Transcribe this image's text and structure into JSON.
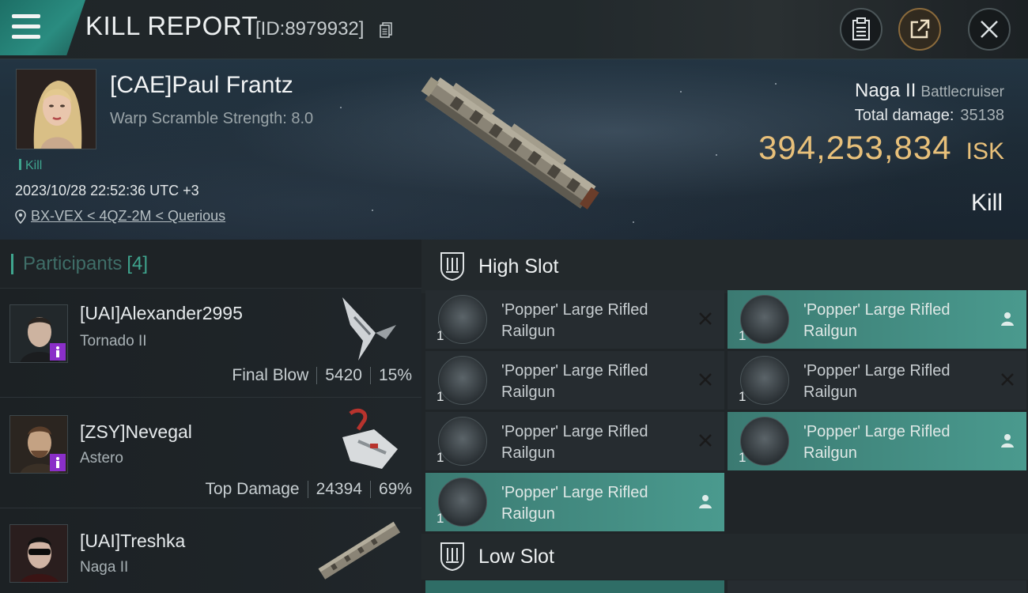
{
  "header": {
    "title": "KILL REPORT",
    "kill_id": "[ID:8979932]",
    "menu_icon": "hamburger-menu-icon",
    "copy_icon": "copy-icon",
    "buttons": [
      {
        "name": "clipboard-report-button",
        "icon": "clipboard-icon"
      },
      {
        "name": "share-export-button",
        "icon": "external-share-icon"
      },
      {
        "name": "close-button",
        "icon": "close-icon"
      }
    ]
  },
  "victim": {
    "name": "[CAE]Paul Frantz",
    "warp_scramble": "Warp Scramble Strength: 8.0",
    "kill_tag": "Kill",
    "timestamp": "2023/10/28 22:52:36 UTC +3",
    "location": "BX-VEX < 4QZ-2M < Querious",
    "ship_name": "Naga II",
    "ship_class": "Battlecruiser",
    "total_damage_label": "Total damage:",
    "total_damage": "35138",
    "isk_value": "394,253,834",
    "isk_unit": "ISK",
    "result": "Kill"
  },
  "participants": {
    "label": "Participants",
    "count": "[4]",
    "items": [
      {
        "name": "[UAI]Alexander2995",
        "ship": "Tornado II",
        "role": "Final Blow",
        "damage": "5420",
        "percent": "15%"
      },
      {
        "name": "[ZSY]Nevegal",
        "ship": "Astero",
        "role": "Top Damage",
        "damage": "24394",
        "percent": "69%"
      },
      {
        "name": "[UAI]Treshka",
        "ship": "Naga II",
        "role": "",
        "damage": "",
        "percent": ""
      }
    ]
  },
  "fitting": {
    "high_slot_label": "High Slot",
    "low_slot_label": "Low Slot",
    "high_slot": [
      {
        "name_line1": "'Popper' Large Rifled",
        "name_line2": "Railgun",
        "qty": "1",
        "state": "destroyed"
      },
      {
        "name_line1": "'Popper' Large Rifled",
        "name_line2": "Railgun",
        "qty": "1",
        "state": "dropped"
      },
      {
        "name_line1": "'Popper' Large Rifled",
        "name_line2": "Railgun",
        "qty": "1",
        "state": "destroyed"
      },
      {
        "name_line1": "'Popper' Large Rifled",
        "name_line2": "Railgun",
        "qty": "1",
        "state": "destroyed"
      },
      {
        "name_line1": "'Popper' Large Rifled",
        "name_line2": "Railgun",
        "qty": "1",
        "state": "destroyed"
      },
      {
        "name_line1": "'Popper' Large Rifled",
        "name_line2": "Railgun",
        "qty": "1",
        "state": "dropped"
      },
      {
        "name_line1": "'Popper' Large Rifled",
        "name_line2": "Railgun",
        "qty": "1",
        "state": "dropped"
      }
    ]
  },
  "colors": {
    "accent": "#3fa58e",
    "isk": "#e8c07a",
    "dropped_row": "#4a9a8e",
    "corp_badge": "#8a2fc8"
  }
}
